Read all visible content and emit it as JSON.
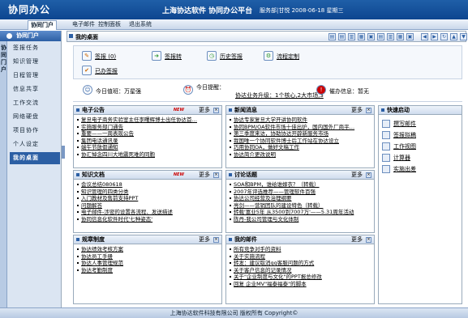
{
  "header": {
    "logo": "协同办公",
    "title": "上海协达软件 协同办公平台",
    "info": "服务部|甘悦 2008-06-18 星期三"
  },
  "nav": {
    "tabs": [
      "协同门户",
      "电子邮件",
      "控制面板",
      "退出系统"
    ]
  },
  "sidebar": {
    "title": "协同门户",
    "vtabs": [
      "协",
      "同",
      "门",
      "户"
    ],
    "items": [
      "签报任务",
      "知识管理",
      "日程管理",
      "信息共享",
      "工作交流",
      "网络硬盘",
      "项目协作",
      "个人设定",
      "我的桌面"
    ]
  },
  "desk": {
    "title": "我的桌面"
  },
  "quick": {
    "qianbao": "签报",
    "qianbao_count": "(0)",
    "sign_forward": "签报转",
    "history": "历史签报",
    "flow": "流程定制",
    "done": "已办签报"
  },
  "status": {
    "duty": "今日值班：万星强",
    "remind": "今日提醒：",
    "remind_text": "协达业务升级：1个核心,2大市场,3",
    "warn": "催办信息：暂无"
  },
  "panels": {
    "announce": {
      "title": "电子公告",
      "more": "更多",
      "new": "NEW",
      "items": [
        "复旦电子商务实验室主任李曙辉博士出任协达首…",
        "实施服务部门通告",
        "重要——一周表现公告",
        "集团电话通讯录",
        "端午节放假通知",
        "协汇悼念四川大地震死难的同胞"
      ]
    },
    "news": {
      "title": "新闻消息",
      "more": "更多",
      "items": [
        "协达专家复旦大学开讲协同软件",
        "协同BPM/OA软件市场十佳出炉，国内国外厂商平…",
        "第三季度来访，协助协达开辟新服务市场",
        "我国唯一个协同软件博士后工作站在协达设立",
        "巧用协同OA，做好文稿工作",
        "协达简介更改说明"
      ]
    },
    "doc": {
      "title": "知识文档",
      "more": "更多",
      "new": "NEW",
      "items": [
        "会议总结080618",
        "知识管理的四类分类",
        "入门教材及售前支持PPT",
        "问题解答",
        "电子邮件-涉密的设置各流程、发送描述",
        "协同信息化软件时代'七种姿态'"
      ]
    },
    "forum": {
      "title": "讨论话题",
      "more": "更多",
      "items": [
        "SOA和BPM，谁给谁嫁衣？（转载）",
        "2007年评选推荐——管理软件百强",
        "协达公司经营及治理纲要",
        "亮剑——营销团队的建设特色（转载）",
        "转载'富业5年 从3500到7007万'——5.31周年活动",
        "陈丹-我公司管理与文化体制"
      ]
    },
    "rules": {
      "title": "规章制度",
      "more": "更多",
      "items": [
        "协达绩效考核方案",
        "协达员工手册",
        "协达人事管理规范",
        "协达考勤制度"
      ]
    },
    "mine": {
      "title": "我的邮件",
      "more": "更多",
      "items": [
        "所有竞争对手的资料",
        "关于实施流程",
        "转发：建议取消gg客服问题的方式",
        "关于客户信息的记录情况",
        "关于\"企业制度与文化\"的PPT报总修改",
        "回复 企业MV\"福泰福泰\"的脚本"
      ]
    }
  },
  "kuai": {
    "title": "快速启动",
    "items": [
      "撰写邮件",
      "签报拟稿",
      "工作视图",
      "计算器",
      "实施出差"
    ]
  },
  "footer": "上海协达软件科技有限公司 版权所有 Copyright©"
}
